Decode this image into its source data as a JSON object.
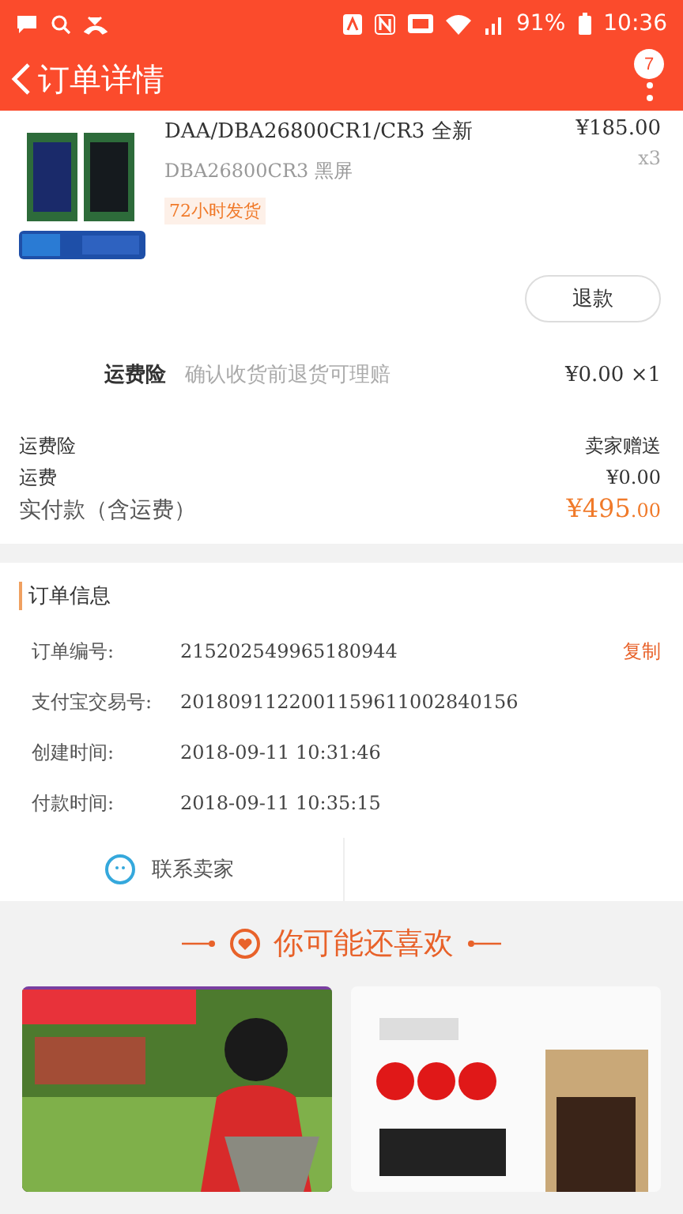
{
  "status_bar": {
    "battery": "91%",
    "time": "10:36"
  },
  "header": {
    "title": "订单详情",
    "badge": "7"
  },
  "product": {
    "title": "DAA/DBA26800CR1/CR3 全新",
    "price": "¥185.00",
    "quantity": "x3",
    "sku": "DBA26800CR3 黑屏",
    "tag": "72小时发货",
    "refund_button": "退款"
  },
  "insurance": {
    "label": "运费险",
    "description": "确认收货前退货可理赔",
    "price": "¥0.00 ×1"
  },
  "summary": [
    {
      "label": "运费险",
      "value": "卖家赠送"
    },
    {
      "label": "运费",
      "value": "¥0.00"
    }
  ],
  "total": {
    "label": "实付款（含运费）",
    "amount": "¥495",
    "decimals": ".00"
  },
  "order_info": {
    "title": "订单信息",
    "rows": [
      {
        "label": "订单编号:",
        "value": "215202549965180944",
        "action": "复制"
      },
      {
        "label": "支付宝交易号:",
        "value": "2018091122001159611002840156"
      },
      {
        "label": "创建时间:",
        "value": "2018-09-11 10:31:46"
      },
      {
        "label": "付款时间:",
        "value": "2018-09-11 10:35:15"
      }
    ],
    "contact": "联系卖家"
  },
  "recommend": {
    "title": "你可能还喜欢"
  }
}
